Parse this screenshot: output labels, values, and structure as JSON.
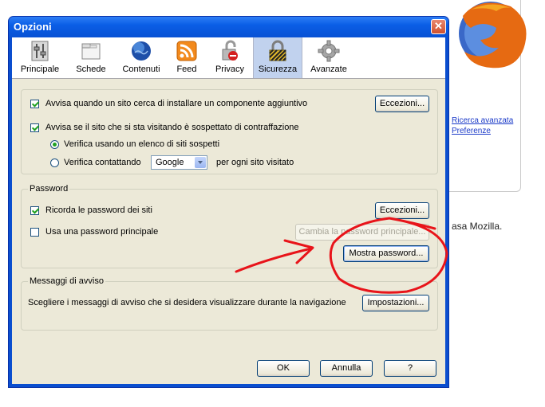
{
  "background": {
    "links": [
      "Ricerca avanzata",
      "Preferenze"
    ],
    "text": "asa Mozilla."
  },
  "window": {
    "title": "Opzioni",
    "close": "✕"
  },
  "toolbar": {
    "items": [
      {
        "label": "Principale",
        "icon": "general-sliders-icon"
      },
      {
        "label": "Schede",
        "icon": "tabs-window-icon"
      },
      {
        "label": "Contenuti",
        "icon": "content-globe-icon"
      },
      {
        "label": "Feed",
        "icon": "rss-feed-icon"
      },
      {
        "label": "Privacy",
        "icon": "privacy-lock-icon"
      },
      {
        "label": "Sicurezza",
        "icon": "security-padlock-icon",
        "selected": true
      },
      {
        "label": "Avanzate",
        "icon": "advanced-gear-icon"
      }
    ]
  },
  "security": {
    "warn_addon": {
      "label": "Avvisa quando un sito cerca di installare un componente aggiuntivo",
      "checked": true
    },
    "warn_forgery": {
      "label": "Avvisa se il sito che si sta visitando è sospettato di contraffazione",
      "checked": true
    },
    "verify_list": {
      "label": "Verifica usando un elenco di siti sospetti",
      "selected": true
    },
    "verify_contact": {
      "label_before": "Verifica contattando",
      "label_after": "per ogni sito visitato",
      "selected": false
    },
    "provider": "Google",
    "exceptions": "Eccezioni..."
  },
  "password": {
    "title": "Password",
    "remember": {
      "label": "Ricorda le password dei siti",
      "checked": true
    },
    "master": {
      "label": "Usa una password principale",
      "checked": false
    },
    "exceptions": "Eccezioni...",
    "change_master": "Cambia la password principale...",
    "show_passwords": "Mostra password..."
  },
  "warnings": {
    "title": "Messaggi di avviso",
    "description": "Scegliere i messaggi di avviso che si desidera visualizzare durante la navigazione",
    "settings": "Impostazioni..."
  },
  "footer": {
    "ok": "OK",
    "cancel": "Annulla",
    "help": "?"
  },
  "colors": {
    "annotation": "#e8141a",
    "title_bar": "#0a5ee6",
    "selected_tab": "#c1d2ee"
  }
}
